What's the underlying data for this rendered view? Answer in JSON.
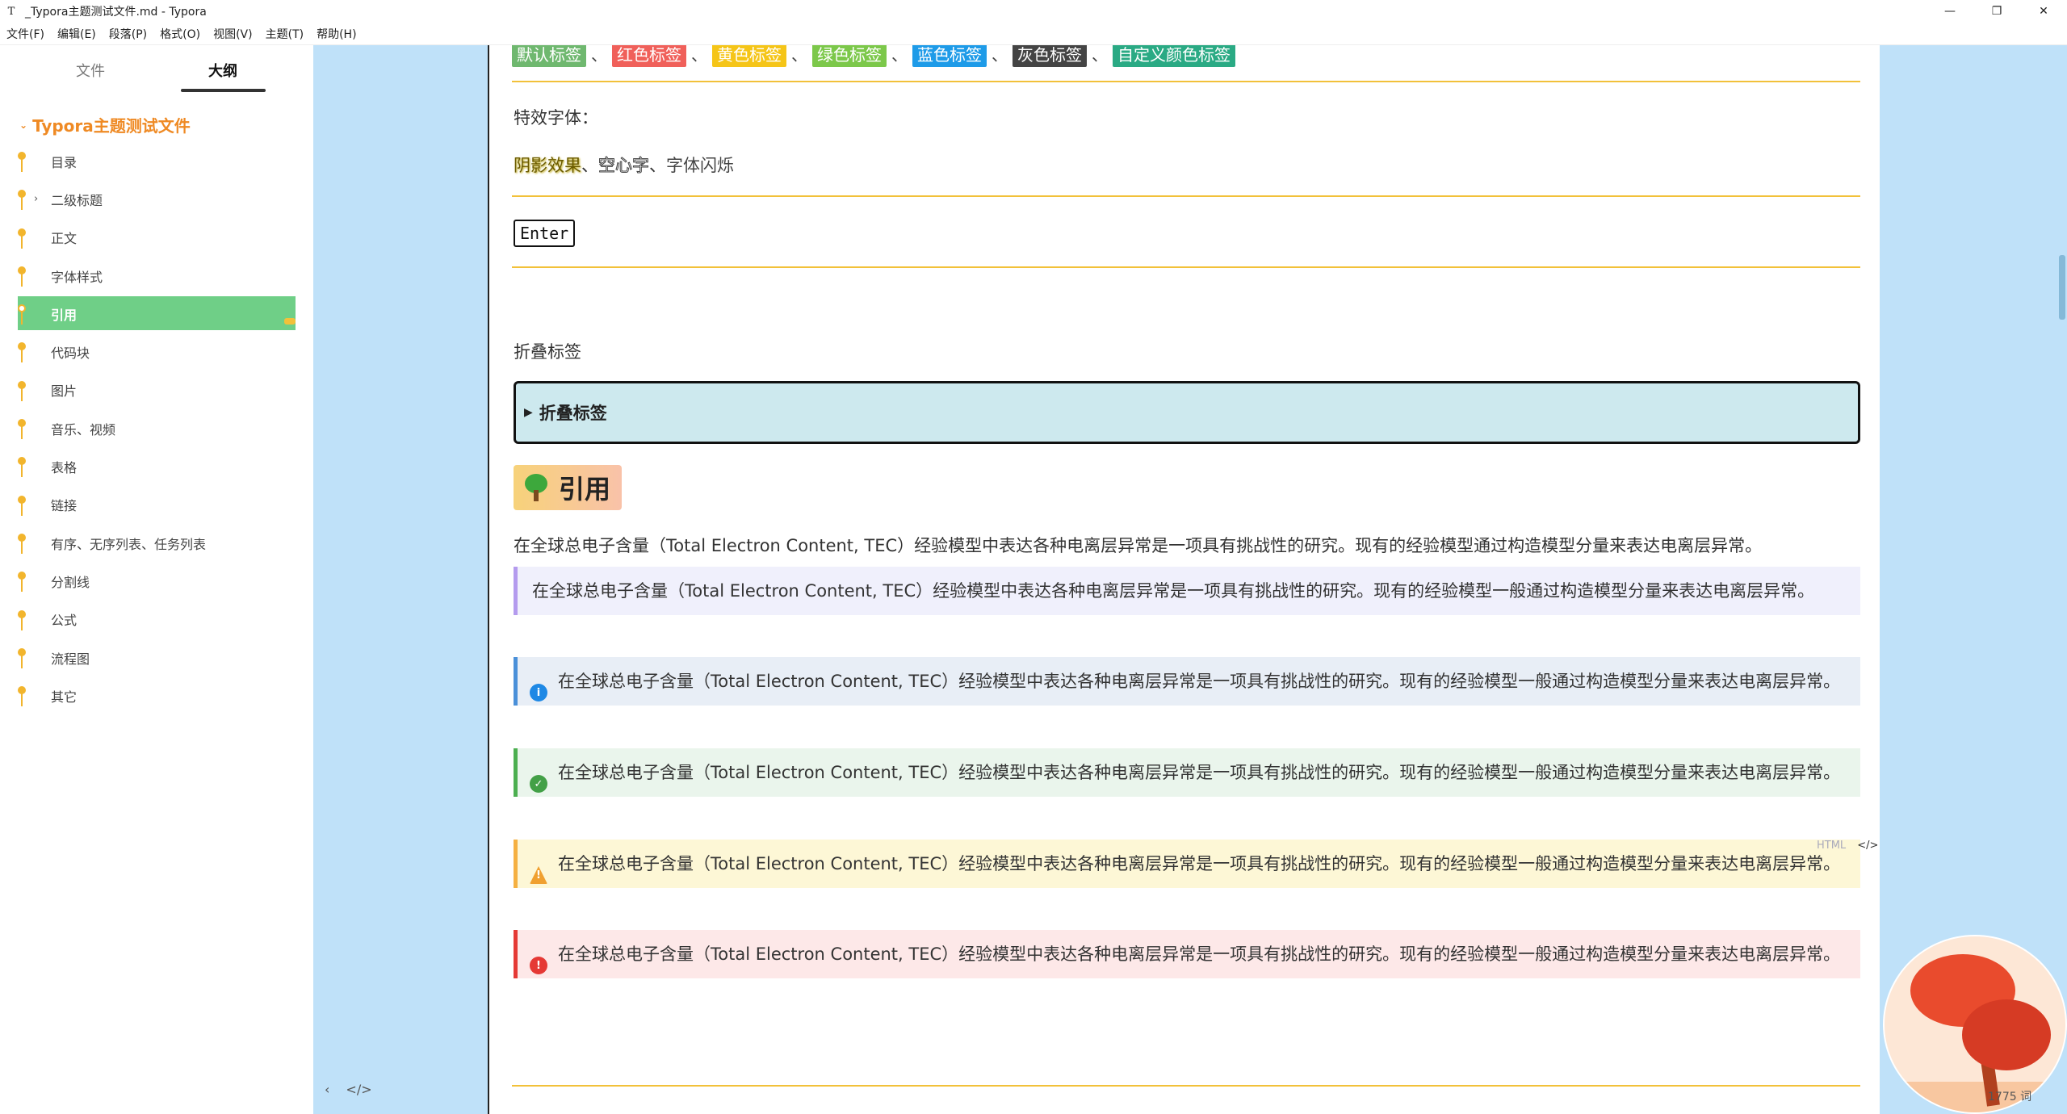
{
  "window": {
    "app_icon_glyph": "T",
    "title": "_Typora主题测试文件.md - Typora",
    "minimize": "—",
    "maximize": "❐",
    "close": "✕"
  },
  "menu": [
    "文件(F)",
    "编辑(E)",
    "段落(P)",
    "格式(O)",
    "视图(V)",
    "主题(T)",
    "帮助(H)"
  ],
  "sidebar": {
    "tab_files": "文件",
    "tab_outline": "大纲",
    "root_title": "Typora主题测试文件",
    "items": [
      {
        "label": "目录",
        "expandable": false,
        "active": false
      },
      {
        "label": "二级标题",
        "expandable": true,
        "active": false
      },
      {
        "label": "正文",
        "expandable": false,
        "active": false
      },
      {
        "label": "字体样式",
        "expandable": false,
        "active": false
      },
      {
        "label": "引用",
        "expandable": false,
        "active": true
      },
      {
        "label": "代码块",
        "expandable": false,
        "active": false
      },
      {
        "label": "图片",
        "expandable": false,
        "active": false
      },
      {
        "label": "音乐、视频",
        "expandable": false,
        "active": false
      },
      {
        "label": "表格",
        "expandable": false,
        "active": false
      },
      {
        "label": "链接",
        "expandable": false,
        "active": false
      },
      {
        "label": "有序、无序列表、任务列表",
        "expandable": false,
        "active": false
      },
      {
        "label": "分割线",
        "expandable": false,
        "active": false
      },
      {
        "label": "公式",
        "expandable": false,
        "active": false
      },
      {
        "label": "流程图",
        "expandable": false,
        "active": false
      },
      {
        "label": "其它",
        "expandable": false,
        "active": false
      }
    ],
    "footer_back": "‹",
    "footer_code": "</>"
  },
  "editor": {
    "tags": [
      {
        "text": "默认标签",
        "color": "#6fb86f"
      },
      {
        "text": "红色标签",
        "color": "#f0605a"
      },
      {
        "text": "黄色标签",
        "color": "#f5c518"
      },
      {
        "text": "绿色标签",
        "color": "#7cc84a"
      },
      {
        "text": "蓝色标签",
        "color": "#1e9be8"
      },
      {
        "text": "灰色标签",
        "color": "#444444"
      },
      {
        "text": "自定义颜色标签",
        "color": "#2aaa84"
      }
    ],
    "tag_separator": "、",
    "effects_label": "特效字体：",
    "effects": {
      "shadow": "阴影效果",
      "sep1": "、",
      "outline": "空心字",
      "sep2": "、",
      "blink": "字体闪烁"
    },
    "kbd": "Enter",
    "collapse_label": "折叠标签",
    "details_summary": "折叠标签",
    "details_marker": "▶",
    "quote_heading": "引用",
    "body_text": "在全球总电子含量（Total Electron Content, TEC）经验模型中表达各种电离层异常是一项具有挑战性的研究。现有的经验模型通过构造模型分量来表达电离层异常。",
    "callouts": [
      {
        "kind": "plain",
        "text": "在全球总电子含量（Total Electron Content, TEC）经验模型中表达各种电离层异常是一项具有挑战性的研究。现有的经验模型一般通过构造模型分量来表达电离层异常。",
        "border": "#b49bee",
        "bg": "#f0f0fc"
      },
      {
        "kind": "info",
        "icon": "i",
        "icon_color": "#1e88e5",
        "text": "在全球总电子含量（Total Electron Content, TEC）经验模型中表达各种电离层异常是一项具有挑战性的研究。现有的经验模型一般通过构造模型分量来表达电离层异常。",
        "border": "#4a90d9",
        "bg": "#e8eef6"
      },
      {
        "kind": "success",
        "icon": "✓",
        "icon_color": "#43a047",
        "text": "在全球总电子含量（Total Electron Content, TEC）经验模型中表达各种电离层异常是一项具有挑战性的研究。现有的经验模型一般通过构造模型分量来表达电离层异常。",
        "border": "#4caf50",
        "bg": "#eaf5ec"
      },
      {
        "kind": "warning",
        "icon": "!",
        "icon_color": "#f0a030",
        "text": "在全球总电子含量（Total Electron Content, TEC）经验模型中表达各种电离层异常是一项具有挑战性的研究。现有的经验模型一般通过构造模型分量来表达电离层异常。",
        "border": "#f5b041",
        "bg": "#fdf7d6"
      },
      {
        "kind": "error",
        "icon": "!",
        "icon_color": "#e53935",
        "text": "在全球总电子含量（Total Electron Content, TEC）经验模型中表达各种电离层异常是一项具有挑战性的研究。现有的经验模型一般通过构造模型分量来表达电离层异常。",
        "border": "#e53935",
        "bg": "#fde8e8"
      }
    ],
    "html_label": "HTML",
    "html_code_icon": "</>"
  },
  "status": {
    "word_count": "1775 词"
  }
}
